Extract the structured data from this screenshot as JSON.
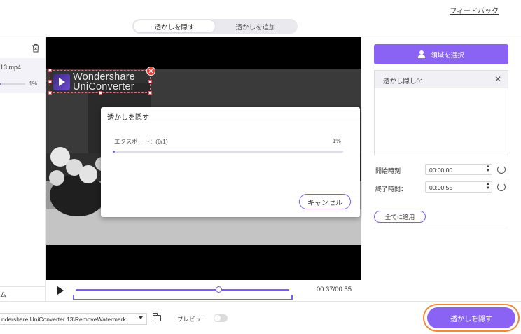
{
  "topbar": {
    "feedback": "フィードバック",
    "tabs": [
      {
        "label": "透かしを隠す",
        "active": true
      },
      {
        "label": "透かしを追加",
        "active": false
      }
    ]
  },
  "files": {
    "items": [
      {
        "name": "13.mp4",
        "progress_label": "1%",
        "progress": 0.01
      }
    ],
    "bottom_label": "ム"
  },
  "video": {
    "watermark": {
      "line1": "Wondershare",
      "line2": "UniConverter"
    },
    "time": "00:37/00:55",
    "playhead_fraction": 0.67
  },
  "dialog": {
    "title": "透かしを隠す",
    "export_label": "エクスポート：(0/1)",
    "percent": "1%",
    "progress": 0.01,
    "cancel": "キャンセル"
  },
  "right": {
    "select_area": "領域を選択",
    "watermarks": [
      {
        "label": "透かし隠し01"
      }
    ],
    "start_label": "開始時刻",
    "start_value": "00:00:00",
    "end_label": "終了時間：",
    "end_value": "00:00:55",
    "apply_all": "全てに適用"
  },
  "bottom": {
    "path": "ndershare UniConverter 13\\RemoveWatermark",
    "preview_label": "プレビュー",
    "preview_on": false,
    "run": "透かしを隠す"
  },
  "colors": {
    "accent": "#8a63f5",
    "highlight_ring": "#f0883a",
    "close_red": "#e53935"
  }
}
